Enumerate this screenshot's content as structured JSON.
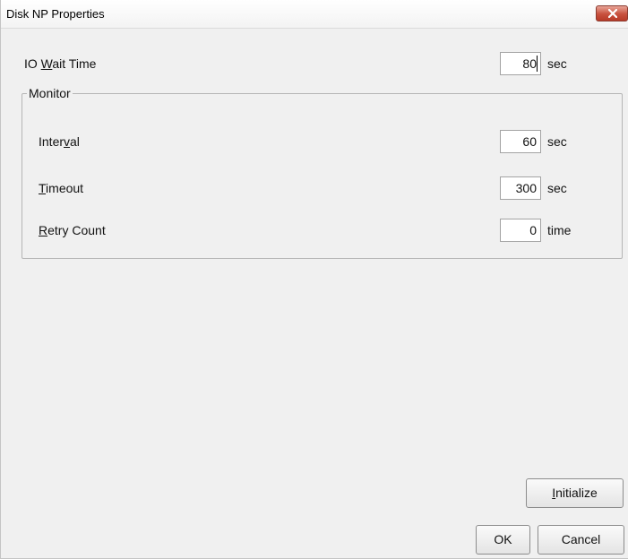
{
  "window": {
    "title": "Disk NP Properties"
  },
  "io_wait": {
    "label_pre": "IO ",
    "label_mnemonic": "W",
    "label_post": "ait Time",
    "value": "80",
    "unit": "sec"
  },
  "monitor": {
    "legend": "Monitor",
    "interval": {
      "label_pre": "Inter",
      "label_mnemonic": "v",
      "label_post": "al",
      "value": "60",
      "unit": "sec"
    },
    "timeout": {
      "label_pre": "",
      "label_mnemonic": "T",
      "label_post": "imeout",
      "value": "300",
      "unit": "sec"
    },
    "retry": {
      "label_pre": "",
      "label_mnemonic": "R",
      "label_post": "etry Count",
      "value": "0",
      "unit": "time"
    }
  },
  "buttons": {
    "initialize_mnemonic": "I",
    "initialize_rest": "nitialize",
    "ok": "OK",
    "cancel": "Cancel"
  },
  "icons": {
    "close": "close-icon"
  },
  "colors": {
    "dialog_bg": "#f0f0f0",
    "close_button": "#c7503d"
  }
}
